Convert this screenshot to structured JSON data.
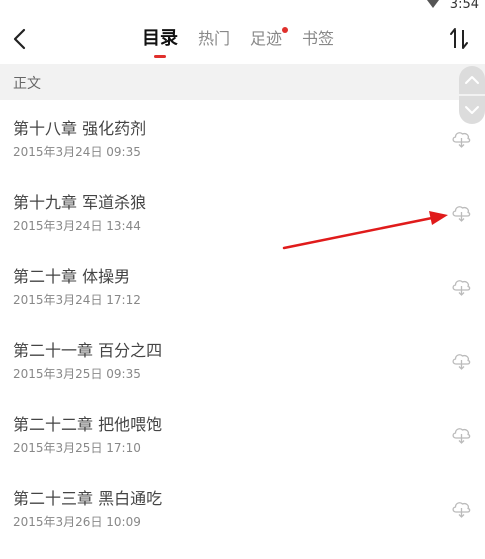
{
  "status": {
    "time": "3:54"
  },
  "header": {
    "tabs": [
      {
        "label": "目录",
        "active": true,
        "badge": false
      },
      {
        "label": "热门",
        "active": false,
        "badge": false
      },
      {
        "label": "足迹",
        "active": false,
        "badge": true
      },
      {
        "label": "书签",
        "active": false,
        "badge": false
      }
    ]
  },
  "section": {
    "label": "正文"
  },
  "chapters": [
    {
      "title": "第十八章 强化药剂",
      "date": "2015年3月24日 09:35"
    },
    {
      "title": "第十九章 军道杀狼",
      "date": "2015年3月24日 13:44"
    },
    {
      "title": "第二十章 体操男",
      "date": "2015年3月24日 17:12"
    },
    {
      "title": "第二十一章 百分之四",
      "date": "2015年3月25日 09:35"
    },
    {
      "title": "第二十二章 把他喂饱",
      "date": "2015年3月25日 17:10"
    },
    {
      "title": "第二十三章 黑白通吃",
      "date": "2015年3月26日 10:09"
    }
  ],
  "colors": {
    "accent": "#e0302c",
    "annotation": "#e01b1b"
  }
}
